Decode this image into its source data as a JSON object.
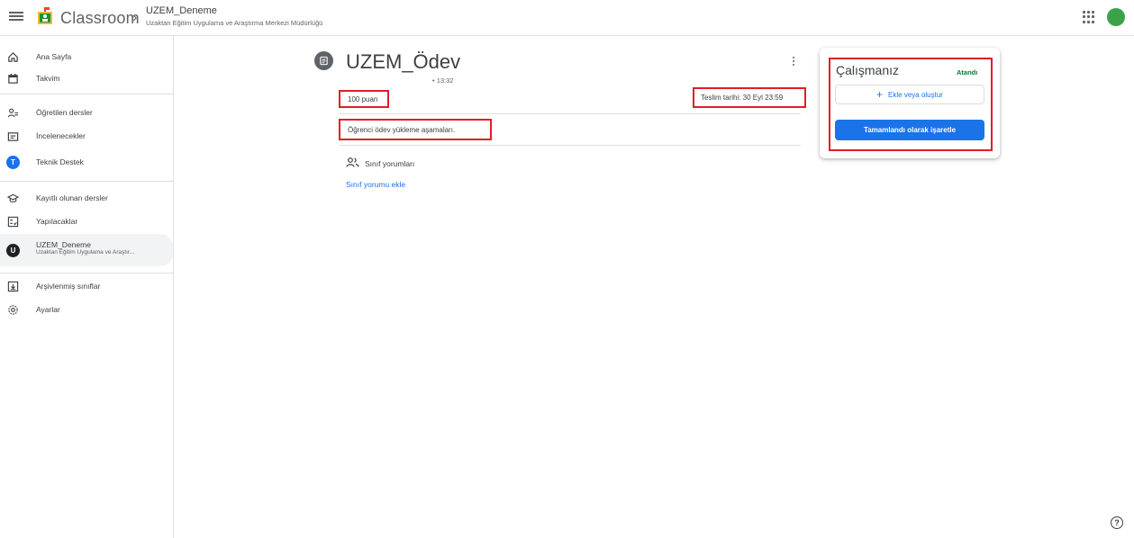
{
  "header": {
    "brand": "Classroom",
    "course_title": "UZEM_Deneme",
    "course_subtitle": "Uzaktan Eğitim Uygulama ve Araştırma Merkezi Müdürlüğü",
    "avatar_color": "#3ba24a"
  },
  "sidebar": {
    "items": [
      {
        "label": "Ana Sayfa",
        "icon": "home-icon"
      },
      {
        "label": "Takvim",
        "icon": "calendar-icon"
      },
      {
        "label": "Öğretilen dersler",
        "icon": "people-icon"
      },
      {
        "label": "İncelenecekler",
        "icon": "folder-icon"
      },
      {
        "label": "Teknik Destek",
        "icon": "avatar-t",
        "badge": "T",
        "badge_color": "#1a73e8"
      },
      {
        "label": "Kayıtlı olunan dersler",
        "icon": "school-icon"
      },
      {
        "label": "Yapılacaklar",
        "icon": "todo-icon"
      },
      {
        "label": "UZEM_Deneme",
        "sub": "Uzaktan Eğitim Uygulama ve Araştır...",
        "icon": "avatar-u",
        "badge": "U",
        "badge_color": "#202124"
      },
      {
        "label": "Arşivlenmiş sınıflar",
        "icon": "archive-icon"
      },
      {
        "label": "Ayarlar",
        "icon": "settings-icon"
      }
    ]
  },
  "assignment": {
    "title": "UZEM_Ödev",
    "time": "• 13:32",
    "points": "100 puan",
    "due": "Teslim tarihi: 30 Eyl 23:59",
    "description": "Öğrenci ödev yükleme aşamaları.",
    "comments_label": "Sınıf yorumları",
    "add_comment": "Sınıf yorumu ekle"
  },
  "your_work": {
    "title": "Çalışmanız",
    "status": "Atandı",
    "add_label": "Ekle veya oluştur",
    "done_label": "Tamamlandı olarak işaretle"
  },
  "colors": {
    "accent": "#1a73e8",
    "highlight": "#e21d26",
    "status_green": "#137333"
  }
}
